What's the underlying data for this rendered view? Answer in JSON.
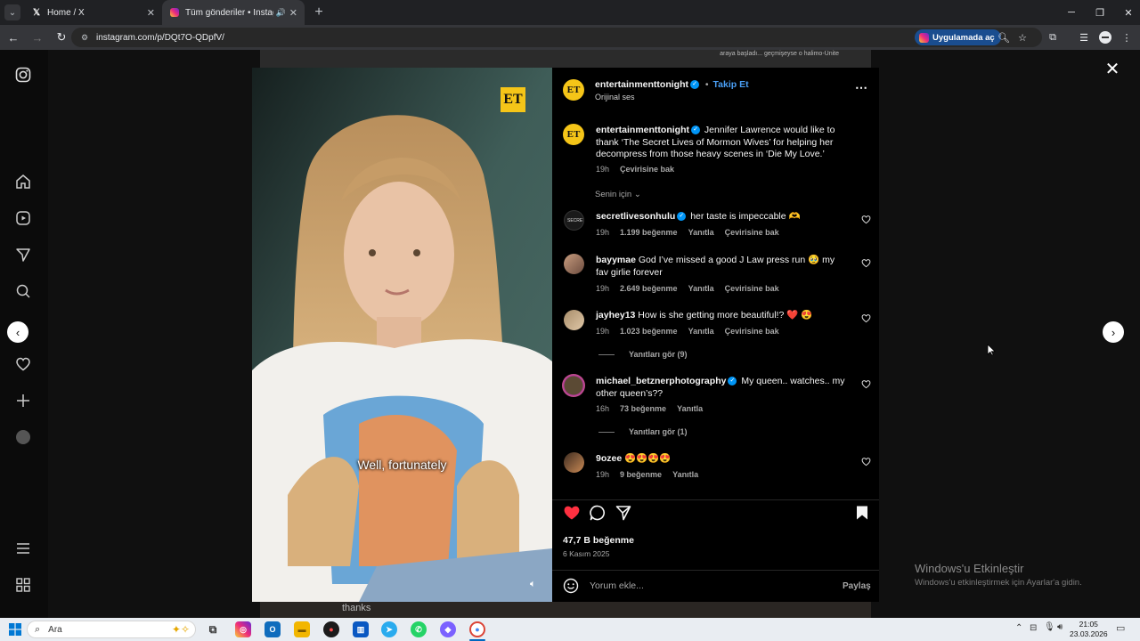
{
  "browser": {
    "tabs": [
      {
        "title": "Home / X",
        "icon": "x-logo-icon",
        "active": false
      },
      {
        "title": "Tüm gönderiler • Instagram",
        "icon": "instagram-icon",
        "active": true
      }
    ],
    "address": "instagram.com/p/DQt7O-QDpfV/",
    "open_in_app_label": "Uygulamada aç"
  },
  "background": {
    "top_caption": "araya başladı... geçmişeyse o halimo-Ünite"
  },
  "video": {
    "logo_text": "ET",
    "subtitle": "Well, fortunately",
    "bottom_caption": "thanks"
  },
  "post": {
    "author": "entertainmenttonight",
    "follow_label": "Takip Et",
    "separator": "•",
    "audio": "Orijinal ses",
    "caption_user": "entertainmenttonight",
    "caption_text": "Jennifer Lawrence would like to thank ‘The Secret Lives of Mormon Wives’ for helping her decompress from those heavy scenes in ‘Die My Love.’",
    "caption_time": "19h",
    "caption_translate": "Çevirisine bak",
    "sort_label": "Senin için",
    "likes": "47,7 B beğenme",
    "date": "6 Kasım 2025",
    "add_comment_placeholder": "Yorum ekle...",
    "post_label": "Paylaş"
  },
  "comments": [
    {
      "user": "secretlivesonhulu",
      "verified": true,
      "text": "her taste is impeccable 🫶",
      "time": "19h",
      "likes": "1.199 beğenme",
      "reply": "Yanıtla",
      "translate": "Çevirisine bak",
      "replies": ""
    },
    {
      "user": "bayymae",
      "verified": false,
      "text": "God I’ve missed a good J Law press run 🥹 my fav girlie forever",
      "time": "19h",
      "likes": "2.649 beğenme",
      "reply": "Yanıtla",
      "translate": "Çevirisine bak",
      "replies": ""
    },
    {
      "user": "jayhey13",
      "verified": false,
      "text": "How is she getting more beautiful!? ❤️ 😍",
      "time": "19h",
      "likes": "1.023 beğenme",
      "reply": "Yanıtla",
      "translate": "Çevirisine bak",
      "replies": "Yanıtları gör (9)"
    },
    {
      "user": "michael_betznerphotography",
      "verified": true,
      "text": "My queen.. watches.. my other queen’s??",
      "time": "16h",
      "likes": "73 beğenme",
      "reply": "Yanıtla",
      "translate": "",
      "replies": "Yanıtları gör (1)"
    },
    {
      "user": "9ozee",
      "verified": false,
      "text": "😍😍😍😍",
      "time": "19h",
      "likes": "9 beğenme",
      "reply": "Yanıtla",
      "translate": "",
      "replies": ""
    }
  ],
  "watermark": {
    "line1": "Windows'u Etkinleştir",
    "line2": "Windows'u etkinleştirmek için Ayarlar'a gidin."
  },
  "taskbar": {
    "search_placeholder": "Ara",
    "time": "21:05",
    "date": "23.03.2026"
  },
  "colors": {
    "accent": "#0095f6",
    "like": "#ff3040",
    "et_yellow": "#f5c518"
  }
}
